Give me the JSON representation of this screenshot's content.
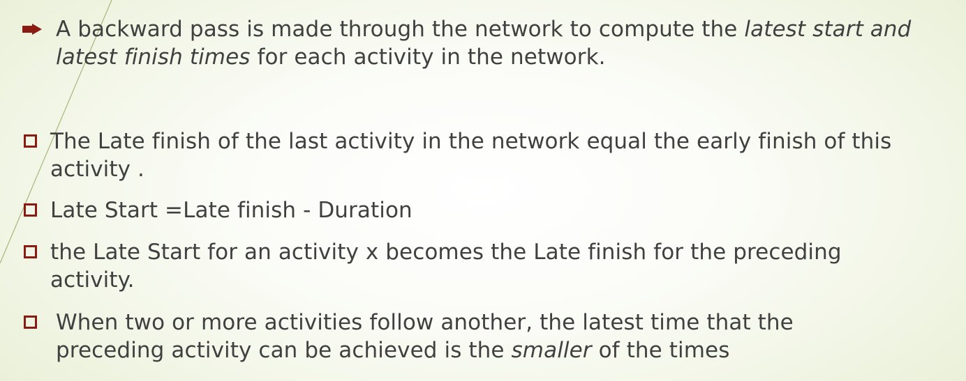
{
  "slide": {
    "intro": {
      "part1": "A backward pass is made through the network to compute the ",
      "italic": "latest start and latest finish times",
      "part2": " for each activity in the network."
    },
    "bullets": [
      {
        "text": "The Late finish of the  last activity in the network equal the early finish of this activity ."
      },
      {
        "text": "Late  Start =Late finish - Duration"
      },
      {
        "text": "the Late Start for an activity x becomes the Late finish for the  preceding activity."
      },
      {
        "part1": "When two or more activities follow another, the latest time that the preceding activity can be achieved is the ",
        "italic": "smaller",
        "part2": " of the times"
      }
    ]
  },
  "colors": {
    "text": "#404040",
    "bullet": "#8b1a10",
    "accent_line": "#9fb06a"
  }
}
